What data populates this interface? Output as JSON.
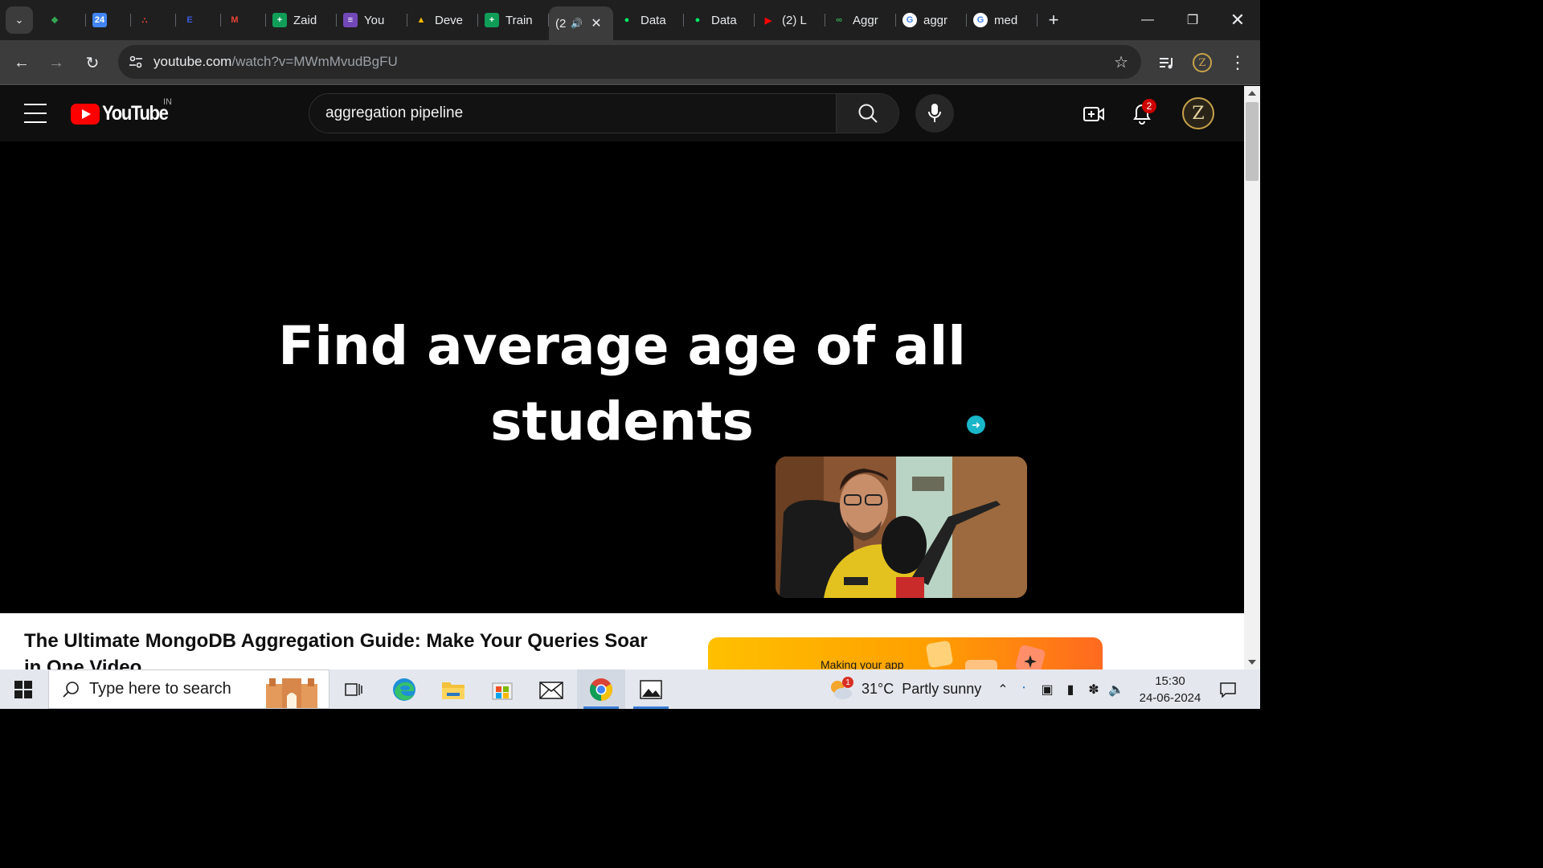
{
  "browser": {
    "tabs": [
      {
        "icon": "calendar-multicolor-icon",
        "title": "",
        "color": "#34a853"
      },
      {
        "icon": "google-calendar-icon",
        "title": "",
        "color": "#4285f4"
      },
      {
        "icon": "dots-app-icon",
        "title": "",
        "color": "#ea4335"
      },
      {
        "icon": "e-app-icon",
        "title": "",
        "color": "#3b5bdb"
      },
      {
        "icon": "gmail-icon",
        "title": "",
        "color": "#ea4335"
      },
      {
        "icon": "google-sheets-icon",
        "title": "Zaid",
        "color": "#0f9d58"
      },
      {
        "icon": "google-forms-icon",
        "title": "You",
        "color": "#7248b9"
      },
      {
        "icon": "google-drive-icon",
        "title": "Deve",
        "color": "#fbbc04"
      },
      {
        "icon": "google-sheets-icon",
        "title": "Train",
        "color": "#0f9d58"
      },
      {
        "icon": "",
        "title": "(2",
        "active": true
      },
      {
        "icon": "mongodb-leaf-icon",
        "title": "Data",
        "color": "#00ed64"
      },
      {
        "icon": "mongodb-leaf-icon",
        "title": "Data",
        "color": "#00ed64"
      },
      {
        "icon": "youtube-icon",
        "title": "(2) L",
        "color": "#ff0000"
      },
      {
        "icon": "link-icon",
        "title": "Aggr",
        "color": "#34a853"
      },
      {
        "icon": "google-g-icon",
        "title": "aggr",
        "color": "#ffffff"
      },
      {
        "icon": "google-g-icon",
        "title": "med",
        "color": "#ffffff"
      }
    ],
    "url_host": "youtube.com",
    "url_path": "/watch?v=MWmMvudBgFU",
    "profile_initial": "Z"
  },
  "youtube": {
    "logo_text": "YouTube",
    "country_code": "IN",
    "search_value": "aggregation pipeline",
    "notifications_count": "2",
    "avatar_initial": "Z",
    "video_caption_line1": "Find average age of all",
    "video_caption_line2": "students",
    "video_title": "The Ultimate MongoDB Aggregation Guide: Make Your Queries Soar in One Video",
    "ad_text": "Making your app"
  },
  "taskbar": {
    "search_placeholder": "Type here to search",
    "weather_temp": "31°C",
    "weather_desc": "Partly sunny",
    "weather_badge": "1",
    "time": "15:30",
    "date": "24-06-2024"
  }
}
